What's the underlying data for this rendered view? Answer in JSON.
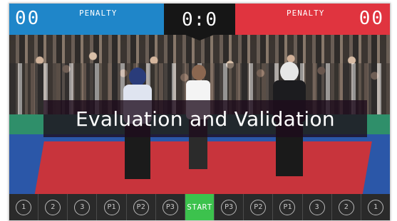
{
  "scoreboard": {
    "blue": {
      "score": "00",
      "penalty_label": "PENALTY",
      "color": "#1f86c9"
    },
    "center": {
      "score": "0:0"
    },
    "red": {
      "score": "00",
      "penalty_label": "PENALTY",
      "color": "#e0343f"
    }
  },
  "overlay": {
    "title": "Evaluation and Validation"
  },
  "controls": {
    "left_buttons": [
      "1",
      "2",
      "3",
      "P1",
      "P2",
      "P3"
    ],
    "start_label": "START",
    "start_color": "#3cc24d",
    "right_buttons": [
      "P3",
      "P2",
      "P1",
      "3",
      "2",
      "1"
    ]
  }
}
